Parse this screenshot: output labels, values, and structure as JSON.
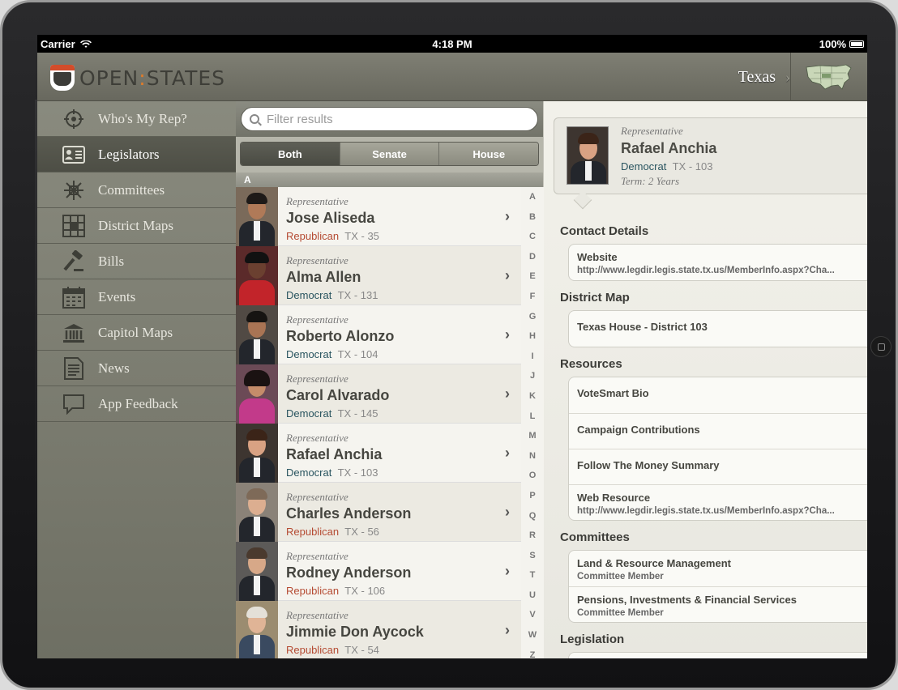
{
  "status_bar": {
    "carrier": "Carrier",
    "time": "4:18 PM",
    "battery": "100%"
  },
  "header": {
    "logo_open": "OPEN",
    "logo_colon": ":",
    "logo_states": "STATES",
    "state": "Texas"
  },
  "sidebar": {
    "items": [
      {
        "label": "Who's My Rep?",
        "icon": "crosshair-icon"
      },
      {
        "label": "Legislators",
        "icon": "contact-card-icon"
      },
      {
        "label": "Committees",
        "icon": "committee-icon"
      },
      {
        "label": "District Maps",
        "icon": "map-grid-icon"
      },
      {
        "label": "Bills",
        "icon": "gavel-icon"
      },
      {
        "label": "Events",
        "icon": "calendar-icon"
      },
      {
        "label": "Capitol Maps",
        "icon": "capitol-icon"
      },
      {
        "label": "News",
        "icon": "news-icon"
      },
      {
        "label": "App Feedback",
        "icon": "speech-bubble-icon"
      }
    ]
  },
  "search": {
    "placeholder": "Filter results"
  },
  "segments": [
    "Both",
    "Senate",
    "House"
  ],
  "section_letter": "A",
  "legislators": [
    {
      "role": "Representative",
      "name": "Jose Aliseda",
      "party": "Republican",
      "district": "TX - 35"
    },
    {
      "role": "Representative",
      "name": "Alma Allen",
      "party": "Democrat",
      "district": "TX - 131"
    },
    {
      "role": "Representative",
      "name": "Roberto Alonzo",
      "party": "Democrat",
      "district": "TX - 104"
    },
    {
      "role": "Representative",
      "name": "Carol Alvarado",
      "party": "Democrat",
      "district": "TX - 145"
    },
    {
      "role": "Representative",
      "name": "Rafael Anchia",
      "party": "Democrat",
      "district": "TX - 103"
    },
    {
      "role": "Representative",
      "name": "Charles Anderson",
      "party": "Republican",
      "district": "TX - 56"
    },
    {
      "role": "Representative",
      "name": "Rodney Anderson",
      "party": "Republican",
      "district": "TX - 106"
    },
    {
      "role": "Representative",
      "name": "Jimmie Don Aycock",
      "party": "Republican",
      "district": "TX - 54"
    }
  ],
  "index_letters": [
    "A",
    "B",
    "C",
    "D",
    "E",
    "F",
    "G",
    "H",
    "I",
    "J",
    "K",
    "L",
    "M",
    "N",
    "O",
    "P",
    "Q",
    "R",
    "S",
    "T",
    "U",
    "V",
    "W",
    "Z"
  ],
  "detail": {
    "role": "Representative",
    "name": "Rafael Anchia",
    "party": "Democrat",
    "district": "TX - 103",
    "term": "Term: 2 Years",
    "contact_title": "Contact Details",
    "website_label": "Website",
    "website_url": "http://www.legdir.legis.state.tx.us/MemberInfo.aspx?Cha...",
    "district_map_title": "District Map",
    "district_map_label": "Texas House - District 103",
    "resources_title": "Resources",
    "resources": [
      "VoteSmart Bio",
      "Campaign Contributions",
      "Follow The Money Summary"
    ],
    "web_resource_label": "Web Resource",
    "web_resource_url": "http://www.legdir.legis.state.tx.us/MemberInfo.aspx?Cha...",
    "committees_title": "Committees",
    "committees": [
      {
        "name": "Land & Resource Management",
        "role": "Committee Member"
      },
      {
        "name": "Pensions, Investments & Financial Services",
        "role": "Committee Member"
      }
    ],
    "legislation_title": "Legislation"
  },
  "colors": {
    "republican": "#b54b33",
    "democrat": "#2a5560",
    "accent": "#e07c2a"
  }
}
